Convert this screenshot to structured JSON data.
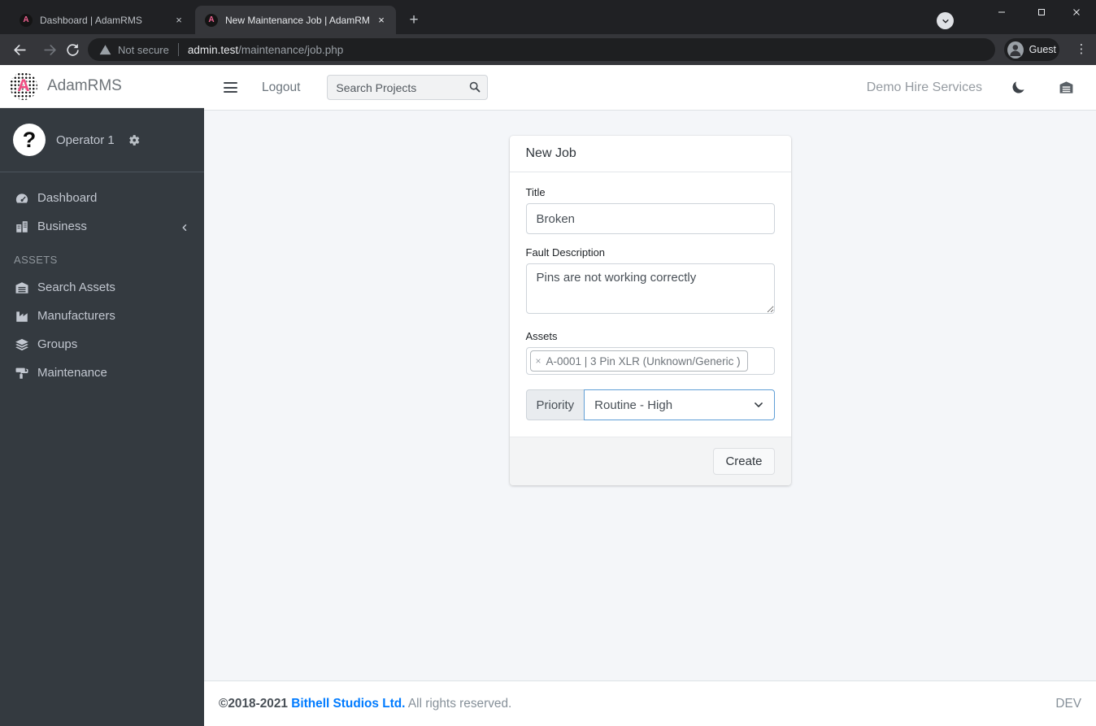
{
  "browser": {
    "tabs": [
      {
        "title": "Dashboard | AdamRMS",
        "favicon_letter": "A",
        "active": false
      },
      {
        "title": "New Maintenance Job | AdamRM",
        "favicon_letter": "A",
        "active": true
      }
    ],
    "tab_close_glyph": "×",
    "new_tab_glyph": "+",
    "menu_dots_glyph": "⋮",
    "address": {
      "security_label": "Not secure",
      "host": "admin.test",
      "path": "/maintenance/job.php"
    },
    "profile_label": "Guest"
  },
  "sidebar": {
    "brand": "AdamRMS",
    "brand_letter": "A",
    "user": {
      "name": "Operator 1",
      "avatar_glyph": "?"
    },
    "nav": [
      {
        "label": "Dashboard",
        "icon": "tachometer-icon"
      },
      {
        "label": "Business",
        "icon": "city-icon"
      }
    ],
    "section_header": "ASSETS",
    "assets_nav": [
      {
        "label": "Search Assets",
        "icon": "warehouse-icon"
      },
      {
        "label": "Manufacturers",
        "icon": "industry-icon"
      },
      {
        "label": "Groups",
        "icon": "layers-icon"
      },
      {
        "label": "Maintenance",
        "icon": "paint-roller-icon"
      }
    ]
  },
  "topbar": {
    "logout_label": "Logout",
    "search_placeholder": "Search Projects",
    "instance_name": "Demo Hire Services"
  },
  "job_form": {
    "heading": "New Job",
    "title": {
      "label": "Title",
      "value": "Broken"
    },
    "fault": {
      "label": "Fault Description",
      "value": "Pins are not working correctly"
    },
    "assets": {
      "label": "Assets",
      "tag": "A-0001 | 3 Pin XLR (Unknown/Generic )",
      "remove_glyph": "×"
    },
    "priority": {
      "label": "Priority",
      "value": "Routine - High"
    },
    "submit_label": "Create"
  },
  "page_footer": {
    "copyright": "©2018-2021",
    "company": "Bithell Studios Ltd.",
    "rights": " All rights reserved.",
    "env": "DEV"
  },
  "colors": {
    "sidebar_bg": "#343a40",
    "content_bg": "#f4f6f9",
    "link_blue": "#007bff",
    "brand_pink": "#ef4b81",
    "select_focus_border": "#609fd6",
    "browser_frame": "#202124",
    "browser_toolbar": "#35363a"
  }
}
